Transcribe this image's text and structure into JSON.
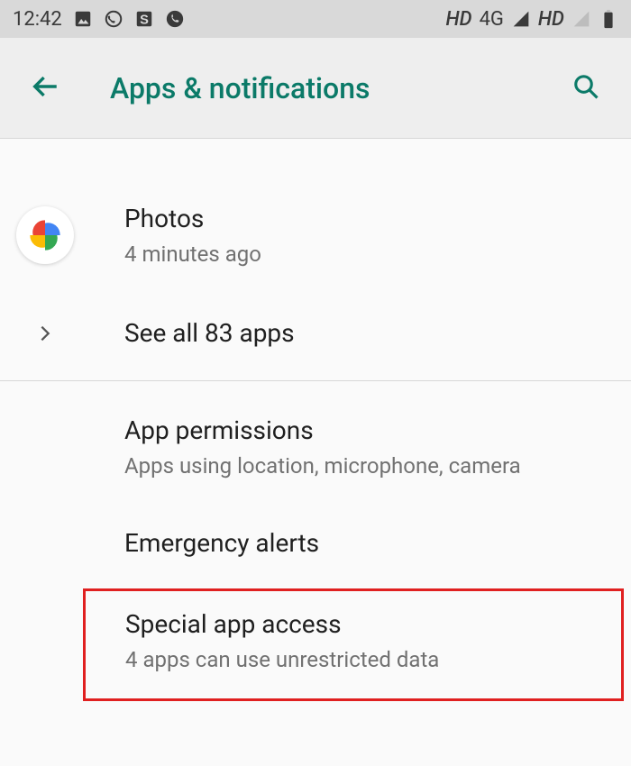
{
  "status": {
    "time": "12:42",
    "net1_label": "HD",
    "net1_type": "4G",
    "net2_label": "HD"
  },
  "header": {
    "title": "Apps & notifications"
  },
  "items": {
    "photos": {
      "title": "Photos",
      "sub": "4 minutes ago"
    },
    "see_all": {
      "title": "See all 83 apps"
    },
    "app_permissions": {
      "title": "App permissions",
      "sub": "Apps using location, microphone, camera"
    },
    "emergency": {
      "title": "Emergency alerts"
    },
    "special": {
      "title": "Special app access",
      "sub": "4 apps can use unrestricted data"
    }
  }
}
